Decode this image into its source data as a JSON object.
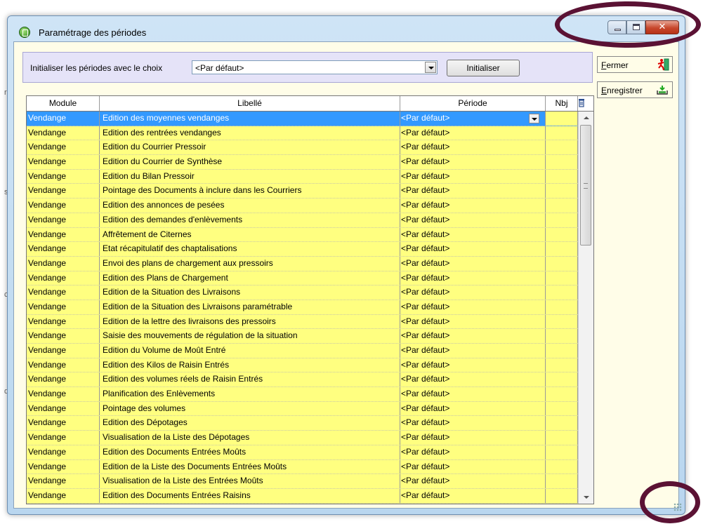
{
  "window": {
    "title": "Paramétrage des périodes"
  },
  "init_panel": {
    "label": "Initialiser les périodes avec le choix",
    "combo_value": "<Par défaut>",
    "button_label": "Initialiser"
  },
  "side_buttons": {
    "close_first": "F",
    "close_rest": "ermer",
    "save_first": "E",
    "save_rest": "nregistrer"
  },
  "grid": {
    "headers": {
      "module": "Module",
      "libelle": "Libellé",
      "periode": "Période",
      "nbj": "Nbj"
    },
    "rows": [
      {
        "module": "Vendange",
        "libelle": "Edition des moyennes vendanges",
        "periode": "<Par défaut>",
        "nbj": ""
      },
      {
        "module": "Vendange",
        "libelle": "Edition des rentrées vendanges",
        "periode": "<Par défaut>",
        "nbj": ""
      },
      {
        "module": "Vendange",
        "libelle": "Edition du Courrier Pressoir",
        "periode": "<Par défaut>",
        "nbj": ""
      },
      {
        "module": "Vendange",
        "libelle": "Edition du Courrier de Synthèse",
        "periode": "<Par défaut>",
        "nbj": ""
      },
      {
        "module": "Vendange",
        "libelle": "Edition du Bilan Pressoir",
        "periode": "<Par défaut>",
        "nbj": ""
      },
      {
        "module": "Vendange",
        "libelle": "Pointage des Documents à inclure dans les Courriers",
        "periode": "<Par défaut>",
        "nbj": ""
      },
      {
        "module": "Vendange",
        "libelle": "Edition des annonces de pesées",
        "periode": "<Par défaut>",
        "nbj": ""
      },
      {
        "module": "Vendange",
        "libelle": "Edition des demandes d'enlèvements",
        "periode": "<Par défaut>",
        "nbj": ""
      },
      {
        "module": "Vendange",
        "libelle": "Affrêtement de Citernes",
        "periode": "<Par défaut>",
        "nbj": ""
      },
      {
        "module": "Vendange",
        "libelle": "Etat récapitulatif des chaptalisations",
        "periode": "<Par défaut>",
        "nbj": ""
      },
      {
        "module": "Vendange",
        "libelle": "Envoi des plans de chargement aux pressoirs",
        "periode": "<Par défaut>",
        "nbj": ""
      },
      {
        "module": "Vendange",
        "libelle": "Edition des Plans de Chargement",
        "periode": "<Par défaut>",
        "nbj": ""
      },
      {
        "module": "Vendange",
        "libelle": "Edition de la Situation des Livraisons",
        "periode": "<Par défaut>",
        "nbj": ""
      },
      {
        "module": "Vendange",
        "libelle": "Edition de la Situation des Livraisons paramétrable",
        "periode": "<Par défaut>",
        "nbj": ""
      },
      {
        "module": "Vendange",
        "libelle": "Edition de la lettre des livraisons des pressoirs",
        "periode": "<Par défaut>",
        "nbj": ""
      },
      {
        "module": "Vendange",
        "libelle": "Saisie des mouvements de régulation de la situation",
        "periode": "<Par défaut>",
        "nbj": ""
      },
      {
        "module": "Vendange",
        "libelle": "Edition du Volume de Moût Entré",
        "periode": "<Par défaut>",
        "nbj": ""
      },
      {
        "module": "Vendange",
        "libelle": "Edition des Kilos de Raisin Entrés",
        "periode": "<Par défaut>",
        "nbj": ""
      },
      {
        "module": "Vendange",
        "libelle": "Edition des volumes réels de Raisin Entrés",
        "periode": "<Par défaut>",
        "nbj": ""
      },
      {
        "module": "Vendange",
        "libelle": "Planification des Enlèvements",
        "periode": "<Par défaut>",
        "nbj": ""
      },
      {
        "module": "Vendange",
        "libelle": "Pointage des volumes",
        "periode": "<Par défaut>",
        "nbj": ""
      },
      {
        "module": "Vendange",
        "libelle": "Edition des Dépotages",
        "periode": "<Par défaut>",
        "nbj": ""
      },
      {
        "module": "Vendange",
        "libelle": "Visualisation de la Liste des Dépotages",
        "periode": "<Par défaut>",
        "nbj": ""
      },
      {
        "module": "Vendange",
        "libelle": "Edition des Documents Entrées Moûts",
        "periode": "<Par défaut>",
        "nbj": ""
      },
      {
        "module": "Vendange",
        "libelle": "Edition de la Liste des Documents Entrées Moûts",
        "periode": "<Par défaut>",
        "nbj": ""
      },
      {
        "module": "Vendange",
        "libelle": "Visualisation de la Liste des Entrées Moûts",
        "periode": "<Par défaut>",
        "nbj": ""
      },
      {
        "module": "Vendange",
        "libelle": "Edition des Documents Entrées Raisins",
        "periode": "<Par défaut>",
        "nbj": ""
      }
    ]
  },
  "colors": {
    "selected_row": "#3399ff",
    "row_background": "#ffff80",
    "panel_background": "#e5e3f8",
    "callout": "#5b1234"
  }
}
